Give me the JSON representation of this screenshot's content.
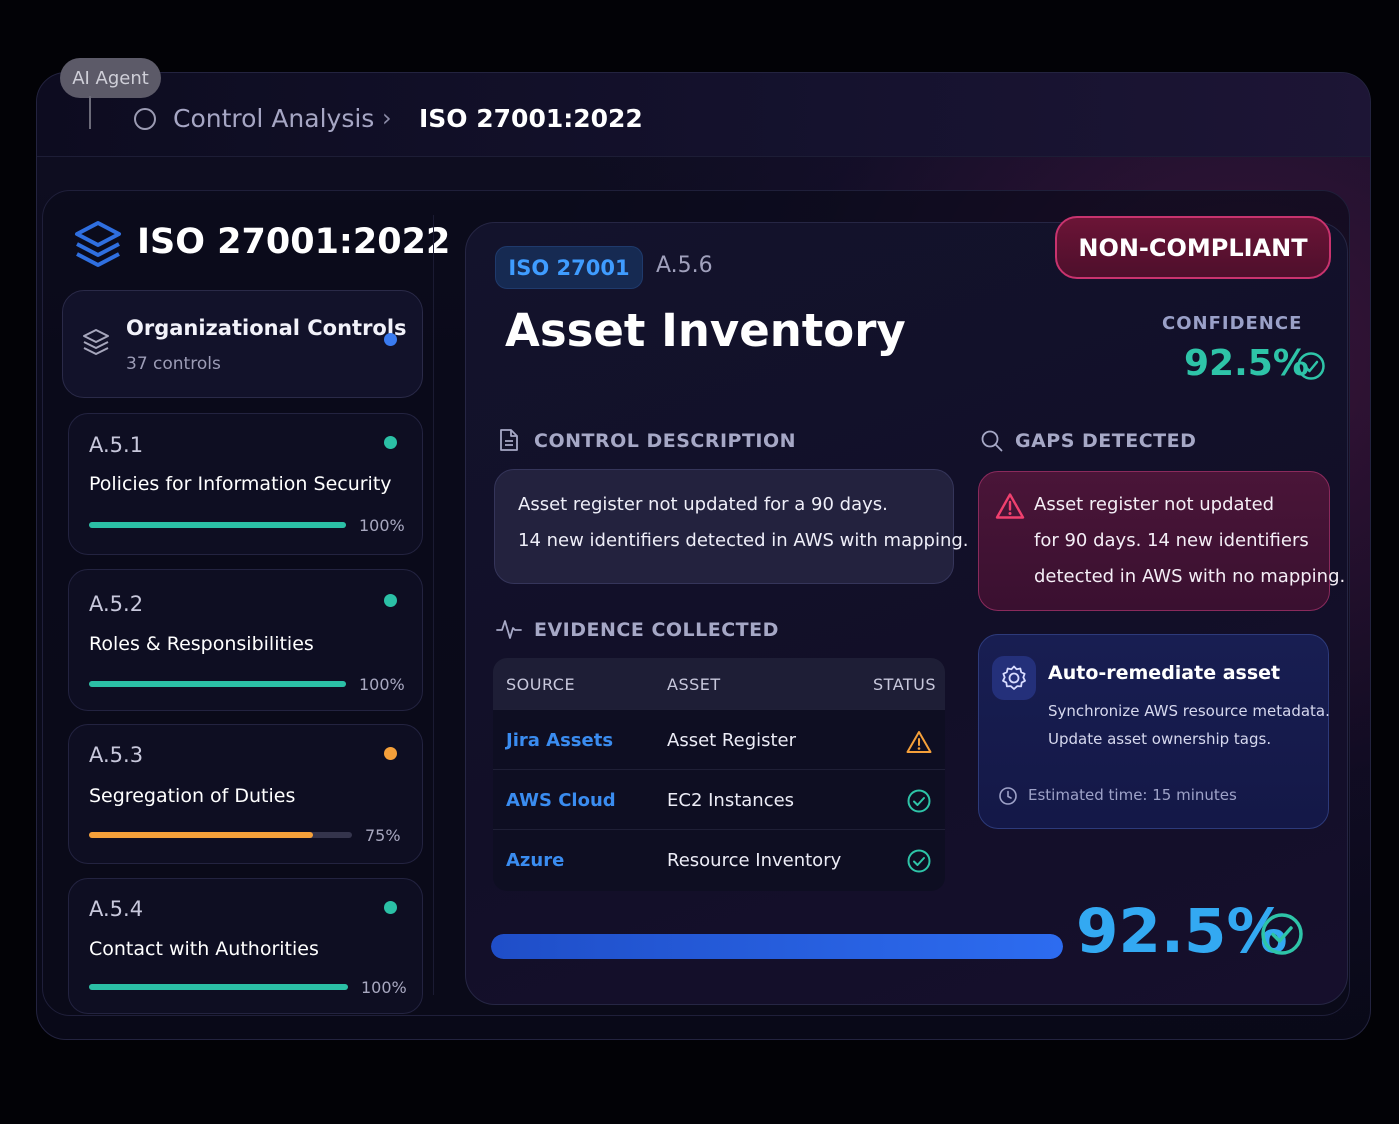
{
  "header": {
    "agent_label": "AI Agent",
    "breadcrumb": [
      "Control Analysis",
      "ISO 27001:2022"
    ]
  },
  "sidebar": {
    "title": "ISO 27001:2022",
    "group": {
      "title": "Organizational Controls",
      "count": "37 controls",
      "dot_color": "#3a7bf0"
    },
    "controls": [
      {
        "id": "A.5.1",
        "name": "Policies for Information Security",
        "progress": 100,
        "progress_label": "100%",
        "color": "#2bc0a6"
      },
      {
        "id": "A.5.2",
        "name": "Roles & Responsibilities",
        "progress": 100,
        "progress_label": "100%",
        "color": "#2bc0a6"
      },
      {
        "id": "A.5.3",
        "name": "Segregation of Duties",
        "progress": 75,
        "progress_label": "75%",
        "color": "#f5a03a"
      },
      {
        "id": "A.5.4",
        "name": "Contact with Authorities",
        "progress": 100,
        "progress_label": "100%",
        "color": "#2bc0a6"
      }
    ]
  },
  "main": {
    "framework_tag": "ISO 27001",
    "control_id": "A.5.6",
    "title": "Asset Inventory",
    "status": "NON-COMPLIANT",
    "confidence_label": "CONFIDENCE",
    "confidence_value": "92.5%",
    "description": {
      "heading": "CONTROL DESCRIPTION",
      "lines": [
        "Asset register not updated for a 90 days.",
        "14 new identifiers detected in AWS with mapping."
      ]
    },
    "gaps": {
      "heading": "GAPS DETECTED",
      "lines": [
        "Asset register not updated",
        "for 90 days. 14 new identifiers",
        "detected in AWS with no mapping."
      ]
    },
    "evidence": {
      "heading": "EVIDENCE COLLECTED",
      "columns": [
        "SOURCE",
        "ASSET",
        "STATUS"
      ],
      "rows": [
        {
          "source": "Jira Assets",
          "asset": "Asset Register",
          "status": "warning"
        },
        {
          "source": "AWS Cloud",
          "asset": "EC2 Instances",
          "status": "ok"
        },
        {
          "source": "Azure",
          "asset": "Resource Inventory",
          "status": "ok"
        }
      ]
    },
    "remediation": {
      "title": "Auto-remediate asset",
      "lines": [
        "Synchronize AWS resource metadata.",
        "Update asset ownership tags."
      ],
      "estimate": "Estimated time: 15 minutes"
    },
    "overall": {
      "progress": 92.5,
      "label": "92.5%"
    }
  },
  "colors": {
    "accent_blue": "#3a8cf0",
    "success": "#2ec4a8",
    "warning": "#f5a03a",
    "danger": "#c8336e"
  }
}
